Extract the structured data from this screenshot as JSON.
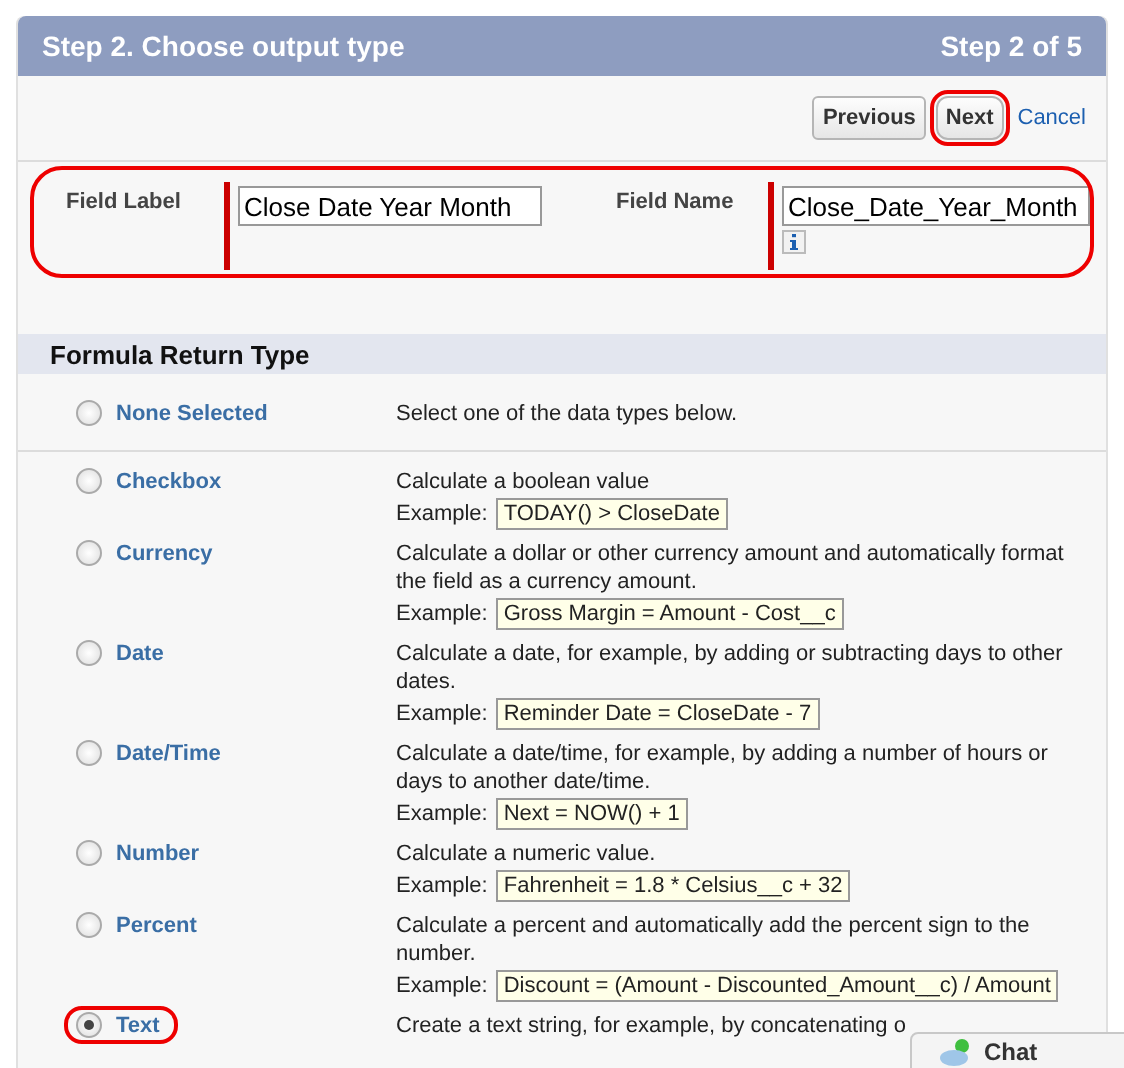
{
  "header": {
    "title": "Step 2. Choose output type",
    "step": "Step 2 of 5"
  },
  "buttons": [
    {
      "label": "Previous",
      "kind": "button",
      "highlighted": false
    },
    {
      "label": "Next",
      "kind": "button",
      "highlighted": true
    },
    {
      "label": "Cancel",
      "kind": "link",
      "highlighted": false
    }
  ],
  "fields": {
    "highlighted": true,
    "items": [
      {
        "label": "Field Label",
        "value": "Close Date Year Month",
        "required": true,
        "info": false
      },
      {
        "label": "Field Name",
        "value": "Close_Date_Year_Month",
        "required": true,
        "info": true
      }
    ]
  },
  "section": {
    "title": "Formula Return Type"
  },
  "types": [
    {
      "label": "None Selected",
      "selected": false,
      "highlighted": false,
      "description": "Select one of the data types below."
    },
    {
      "label": "Checkbox",
      "selected": false,
      "highlighted": false,
      "description": "Calculate a boolean value",
      "example_label": "Example:",
      "example": "TODAY() > CloseDate"
    },
    {
      "label": "Currency",
      "selected": false,
      "highlighted": false,
      "description": "Calculate a dollar or other currency amount and automatically format the field as a currency amount.",
      "example_label": "Example:",
      "example": "Gross Margin = Amount - Cost__c"
    },
    {
      "label": "Date",
      "selected": false,
      "highlighted": false,
      "description": "Calculate a date, for example, by adding or subtracting days to other dates.",
      "example_label": "Example:",
      "example": "Reminder Date = CloseDate - 7"
    },
    {
      "label": "Date/Time",
      "selected": false,
      "highlighted": false,
      "description": "Calculate a date/time, for example, by adding a number of hours or days to another date/time.",
      "example_label": "Example:",
      "example": "Next = NOW() + 1"
    },
    {
      "label": "Number",
      "selected": false,
      "highlighted": false,
      "description": "Calculate a numeric value.",
      "example_label": "Example:",
      "example": "Fahrenheit = 1.8 * Celsius__c + 32"
    },
    {
      "label": "Percent",
      "selected": false,
      "highlighted": false,
      "description": "Calculate a percent and automatically add the percent sign to the number.",
      "example_label": "Example:",
      "example": "Discount = (Amount - Discounted_Amount__c) / Amount"
    },
    {
      "label": "Text",
      "selected": true,
      "highlighted": true,
      "description": "Create a text string, for example, by concatenating o"
    }
  ],
  "chat": {
    "label": "Chat"
  }
}
